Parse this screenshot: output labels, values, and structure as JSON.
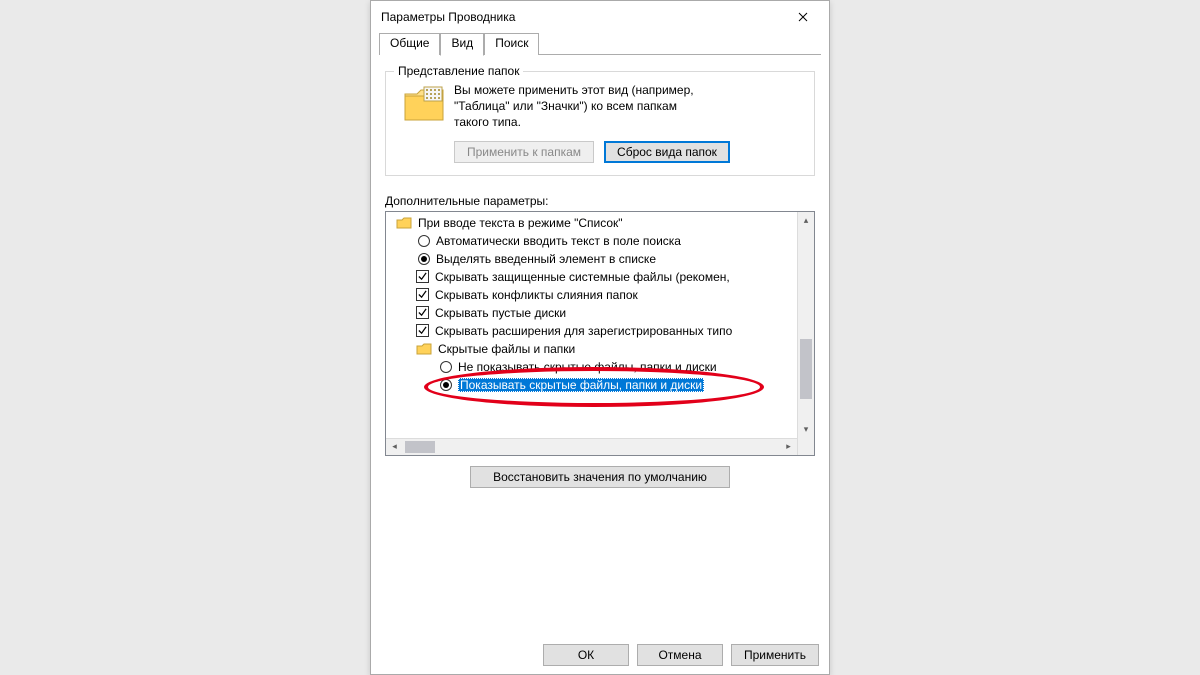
{
  "window": {
    "title": "Параметры Проводника"
  },
  "tabs": {
    "general": "Общие",
    "view": "Вид",
    "search": "Поиск"
  },
  "folderViews": {
    "legend": "Представление папок",
    "description_line1": "Вы можете применить этот вид (например,",
    "description_line2": "\"Таблица\" или \"Значки\") ко всем папкам",
    "description_line3": "такого типа.",
    "applyBtn": "Применить к папкам",
    "resetBtn": "Сброс вида папок"
  },
  "advanced": {
    "label": "Дополнительные параметры:",
    "rows": {
      "r0": "При вводе текста в режиме \"Список\"",
      "r1": "Автоматически вводить текст в поле поиска",
      "r2": "Выделять введенный элемент в списке",
      "r3": "Скрывать защищенные системные файлы (рекомен,",
      "r4": "Скрывать конфликты слияния папок",
      "r5": "Скрывать пустые диски",
      "r6": "Скрывать расширения для зарегистрированных типо",
      "r7": "Скрытые файлы и папки",
      "r8": "Не показывать скрытые файлы, папки и диски",
      "r9": "Показывать скрытые файлы, папки и диски"
    }
  },
  "restoreDefaults": "Восстановить значения по умолчанию",
  "footer": {
    "ok": "ОК",
    "cancel": "Отмена",
    "apply": "Применить"
  }
}
